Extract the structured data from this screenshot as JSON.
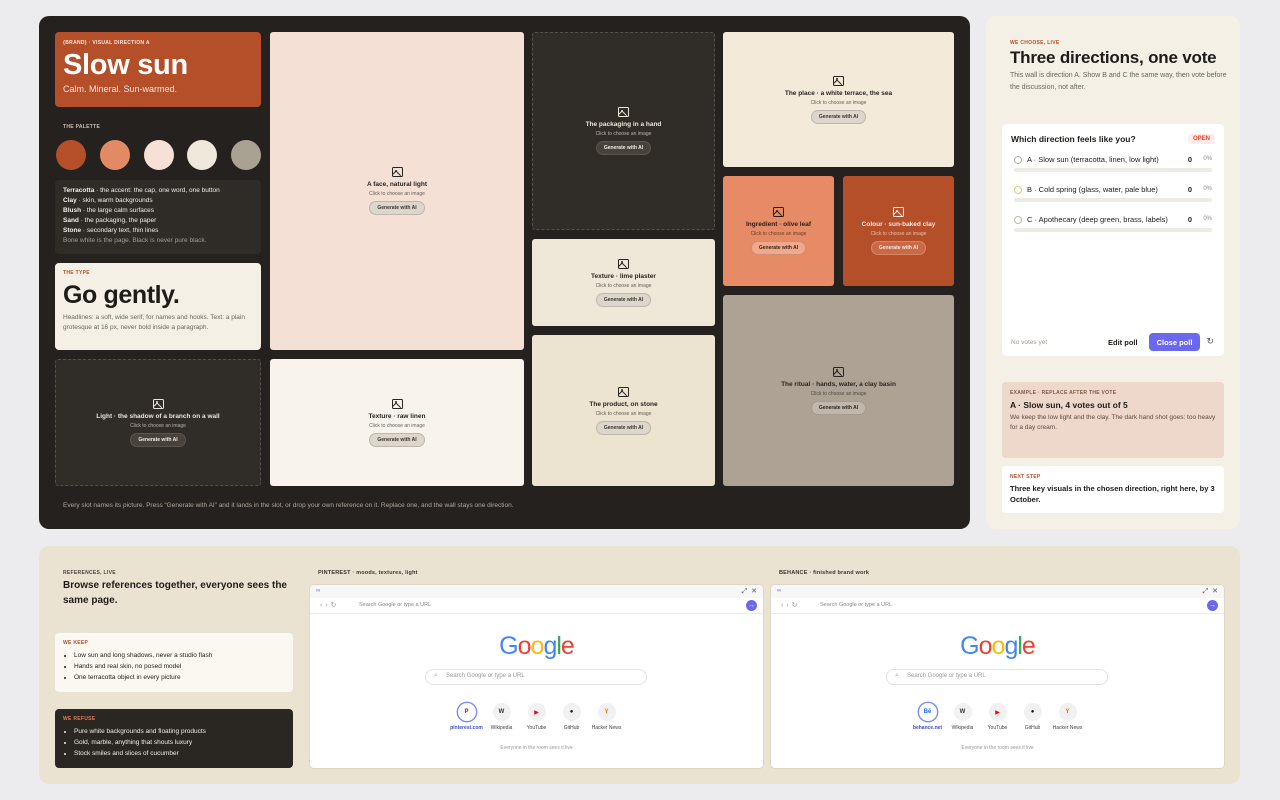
{
  "board": {
    "hero": {
      "eyebrow": "{BRAND} · VISUAL DIRECTION A",
      "title": "Slow sun",
      "subtitle": "Calm. Mineral. Sun-warmed."
    },
    "palette": {
      "label": "THE PALETTE",
      "swatches": [
        {
          "name": "Terracotta",
          "color": "#b44f2a"
        },
        {
          "name": "Clay",
          "color": "#e28a64"
        },
        {
          "name": "Blush",
          "color": "#f6e1d6"
        },
        {
          "name": "Sand",
          "color": "#efe9db"
        },
        {
          "name": "Stone",
          "color": "#a9a191"
        }
      ],
      "notes": [
        {
          "name": "Terracotta",
          "desc": " · the accent: the cap, one word, one button"
        },
        {
          "name": "Clay",
          "desc": " · skin, warm backgrounds"
        },
        {
          "name": "Blush",
          "desc": " · the large calm surfaces"
        },
        {
          "name": "Sand",
          "desc": " · the packaging, the paper"
        },
        {
          "name": "Stone",
          "desc": " · secondary text, thin lines"
        }
      ],
      "footnote": "Bone white is the page. Black is never pure black."
    },
    "type": {
      "eyebrow": "THE TYPE",
      "title": "Go gently.",
      "body": "Headlines: a soft, wide serif, for names and hooks. Text: a plain grotesque at 16 px, never bold inside a paragraph."
    },
    "slot_hint": "Click to choose an image",
    "slot_button": "Generate with AI",
    "slots": [
      {
        "title": "A face, natural light"
      },
      {
        "title": "The packaging in a hand"
      },
      {
        "title": "The place · a white terrace, the sea"
      },
      {
        "title": "Ingredient · olive leaf"
      },
      {
        "title": "Colour · sun-baked clay"
      },
      {
        "title": "Texture · lime plaster"
      },
      {
        "title": "The ritual · hands, water, a clay basin"
      },
      {
        "title": "The product, on stone"
      },
      {
        "title": "Light · the shadow of a branch on a wall"
      },
      {
        "title": "Texture · raw linen"
      }
    ],
    "footer": "Every slot names its picture. Press “Generate with AI” and it lands in the slot, or drop your own reference on it. Replace one, and the wall stays one direction."
  },
  "poll_column": {
    "eyebrow": "WE CHOOSE, LIVE",
    "title": "Three directions, one vote",
    "intro": "This wall is direction A. Show B and C the same way, then vote before the discussion, not after.",
    "poll": {
      "question": "Which direction feels like you?",
      "status": "OPEN",
      "options": [
        {
          "label": "A · Slow sun (terracotta, linen, low light)",
          "count": "0",
          "pct": "0%",
          "fraction": 0
        },
        {
          "label": "B · Cold spring (glass, water, pale blue)",
          "count": "0",
          "pct": "0%",
          "fraction": 0
        },
        {
          "label": "C · Apothecary (deep green, brass, labels)",
          "count": "0",
          "pct": "0%",
          "fraction": 0
        }
      ],
      "no_votes": "No votes yet",
      "edit_label": "Edit poll",
      "close_label": "Close poll"
    },
    "example": {
      "eyebrow": "EXAMPLE · REPLACE AFTER THE VOTE",
      "title": "A · Slow sun, 4 votes out of 5",
      "body": "We keep the low light and the clay. The dark hand shot goes: too heavy for a day cream."
    },
    "next_step": {
      "eyebrow": "NEXT STEP",
      "text": "Three key visuals in the chosen direction, right here, by 3 October."
    }
  },
  "references": {
    "eyebrow": "REFERENCES, LIVE",
    "title": "Browse references together, everyone sees the same page.",
    "keep": {
      "eyebrow": "WE KEEP",
      "items": [
        "Low sun and long shadows, never a studio flash",
        "Hands and real skin, no posed model",
        "One terracotta object in every picture"
      ]
    },
    "refuse": {
      "eyebrow": "WE REFUSE",
      "items": [
        "Pure white backgrounds and floating products",
        "Gold, marble, anything that shouts luxury",
        "Stock smiles and slices of cucumber"
      ]
    },
    "browsers": [
      {
        "label": "PINTEREST · moods, textures, light",
        "url_placeholder": "Search Google or type a URL",
        "search_placeholder": "Search Google or type a URL",
        "shortcuts": [
          {
            "name": "pinterest.com",
            "glyph": "P",
            "color": "#e60023",
            "active": true
          },
          {
            "name": "Wikipedia",
            "glyph": "W",
            "color": "#333333",
            "active": false
          },
          {
            "name": "YouTube",
            "glyph": "▶",
            "color": "#ff0000",
            "active": false
          },
          {
            "name": "GitHub",
            "glyph": "●",
            "color": "#111111",
            "active": false
          },
          {
            "name": "Hacker News",
            "glyph": "Y",
            "color": "#ff6600",
            "active": false
          }
        ],
        "footer": "Everyone in the room sees it live"
      },
      {
        "label": "BEHANCE · finished brand work",
        "url_placeholder": "Search Google or type a URL",
        "search_placeholder": "Search Google or type a URL",
        "shortcuts": [
          {
            "name": "behance.net",
            "glyph": "Bē",
            "color": "#1769ff",
            "active": true
          },
          {
            "name": "Wikipedia",
            "glyph": "W",
            "color": "#333333",
            "active": false
          },
          {
            "name": "YouTube",
            "glyph": "▶",
            "color": "#ff0000",
            "active": false
          },
          {
            "name": "GitHub",
            "glyph": "●",
            "color": "#111111",
            "active": false
          },
          {
            "name": "Hacker News",
            "glyph": "Y",
            "color": "#ff6600",
            "active": false
          }
        ],
        "footer": "Everyone in the room sees it live"
      }
    ],
    "google_wordmark": [
      "G",
      "o",
      "o",
      "g",
      "l",
      "e"
    ]
  }
}
